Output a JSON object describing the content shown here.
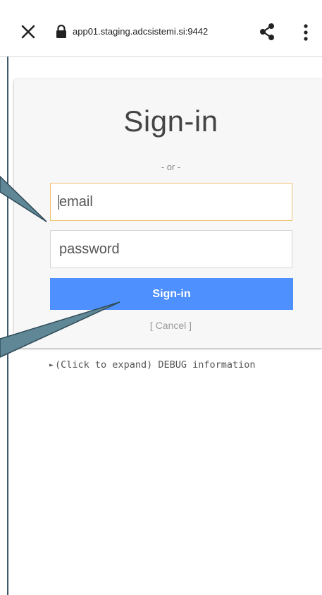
{
  "browser": {
    "url": "app01.staging.adcsistemi.si:9442",
    "close_icon": "close-icon",
    "lock_icon": "lock-icon",
    "share_icon": "share-icon",
    "more_icon": "more-vert-icon"
  },
  "login": {
    "title": "Sign-in",
    "separator": "- or -",
    "email_placeholder": "email",
    "password_placeholder": "password",
    "signin_label": "Sign-in",
    "cancel_label": "[ Cancel ]"
  },
  "debug": {
    "arrow": "►",
    "label": "(Click to expand) DEBUG information"
  },
  "colors": {
    "button_blue": "#4d90fe",
    "email_focus_border": "#f0c070",
    "callout_fill": "#5f8796",
    "callout_stroke": "#2f4a57"
  }
}
